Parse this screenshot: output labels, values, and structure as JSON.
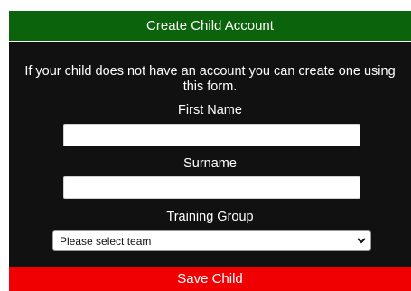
{
  "form": {
    "title": "Create Child Account",
    "intro": "If your child does not have an account you can create one using this form.",
    "first_name_label": "First Name",
    "first_name_value": "",
    "surname_label": "Surname",
    "surname_value": "",
    "training_group_label": "Training Group",
    "training_group_selected": "Please select team",
    "save_label": "Save Child"
  },
  "colors": {
    "header_bg": "#0b640b",
    "panel_bg": "#111111",
    "save_button_bg": "#f00000",
    "text": "#ffffff"
  },
  "icons": {
    "select_arrow": "chevron-down-icon"
  }
}
